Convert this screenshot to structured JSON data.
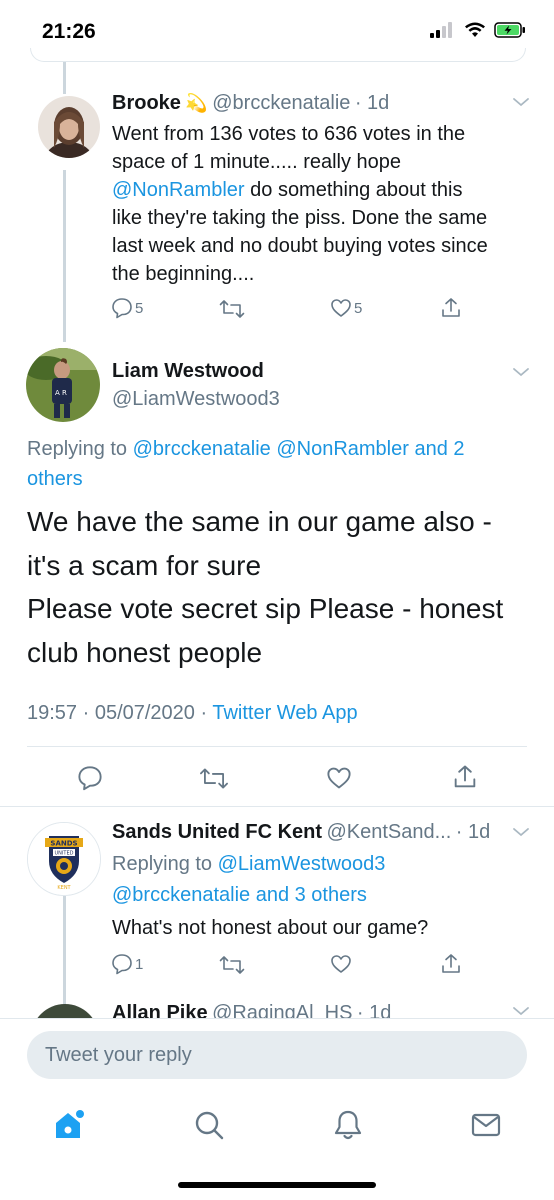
{
  "status": {
    "time": "21:26"
  },
  "tweets": [
    {
      "name": "Brooke",
      "emoji": "💫",
      "handle": "@brcckenatalie",
      "age": "· 1d",
      "lines": [
        "Went from 136 votes to 636 votes in the",
        "space of 1 minute..... really hope",
        "like they're taking the piss. Done the same",
        "last week and no doubt buying votes since",
        "the beginning...."
      ],
      "mention": "@NonRambler",
      "mention_rest": " do something about this",
      "replies": "5",
      "likes": "5"
    },
    {
      "name": "Liam Westwood",
      "handle": "@LiamWestwood3",
      "replying_prefix": "Replying to ",
      "replying_handles": "@brcckenatalie @NonRambler and 2",
      "replying_others": "others",
      "lines": [
        "We have the same in our game also -",
        "it's a scam for sure",
        "Please vote secret sip Please - honest",
        "club honest people"
      ],
      "timestamp": "19:57 · 05/07/2020 ·",
      "source": "Twitter Web App"
    },
    {
      "name": "Sands United FC Kent",
      "handle": "@KentSand...",
      "age": "· 1d",
      "replying_prefix": "Replying to ",
      "replying_line1": "@LiamWestwood3",
      "replying_line2": "@brcckenatalie and 3 others",
      "text": "What's not honest about our game?",
      "replies": "1",
      "badge_top": "SANDS",
      "badge_mid": "UNITED",
      "badge_bottom": "KENT"
    },
    {
      "name": "Allan Pike",
      "handle": "@RagingAl_HS",
      "age": "· 1d"
    }
  ],
  "reply_bar": {
    "placeholder": "Tweet your reply"
  },
  "colors": {
    "link": "#1b95e0",
    "muted": "#657786",
    "text": "#14171a",
    "line": "#ccd6dd"
  },
  "icons": [
    "home-icon",
    "search-icon",
    "notifications-icon",
    "messages-icon"
  ]
}
